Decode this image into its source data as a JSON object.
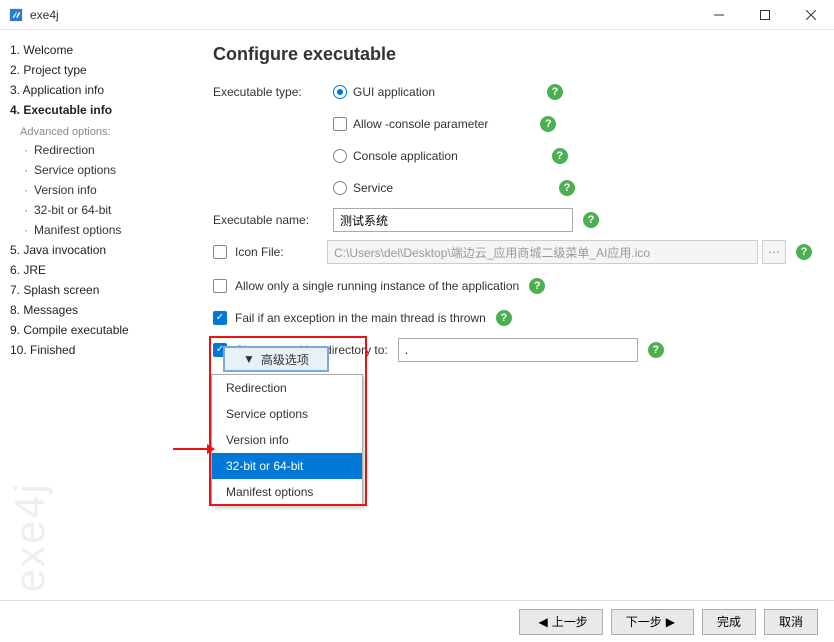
{
  "window": {
    "title": "exe4j"
  },
  "sidebar": {
    "steps": [
      "1. Welcome",
      "2. Project type",
      "3. Application info",
      "4. Executable info",
      "5. Java invocation",
      "6. JRE",
      "7. Splash screen",
      "8. Messages",
      "9. Compile executable",
      "10. Finished"
    ],
    "advanced_label": "Advanced options:",
    "advanced": [
      "Redirection",
      "Service options",
      "Version info",
      "32-bit or 64-bit",
      "Manifest options"
    ],
    "watermark": "exe4j"
  },
  "content": {
    "heading": "Configure executable",
    "exec_type_label": "Executable type:",
    "opt_gui": "GUI application",
    "opt_console_param": "Allow -console parameter",
    "opt_console": "Console application",
    "opt_service": "Service",
    "exec_name_label": "Executable name:",
    "exec_name_value": "测试系统",
    "icon_file_label": "Icon File:",
    "icon_file_value": "C:\\Users\\del\\Desktop\\端边云_应用商城二级菜单_AI应用.ico",
    "chk_single": "Allow only a single running instance of the application",
    "chk_fail": "Fail if an exception in the main thread is thrown",
    "chk_cwd": "Change working directory to:",
    "cwd_value": ".",
    "adv_button": "高级选项",
    "menu": [
      "Redirection",
      "Service options",
      "Version info",
      "32-bit or 64-bit",
      "Manifest options"
    ]
  },
  "footer": {
    "prev": "上一步",
    "next": "下一步",
    "finish": "完成",
    "cancel": "取消"
  }
}
